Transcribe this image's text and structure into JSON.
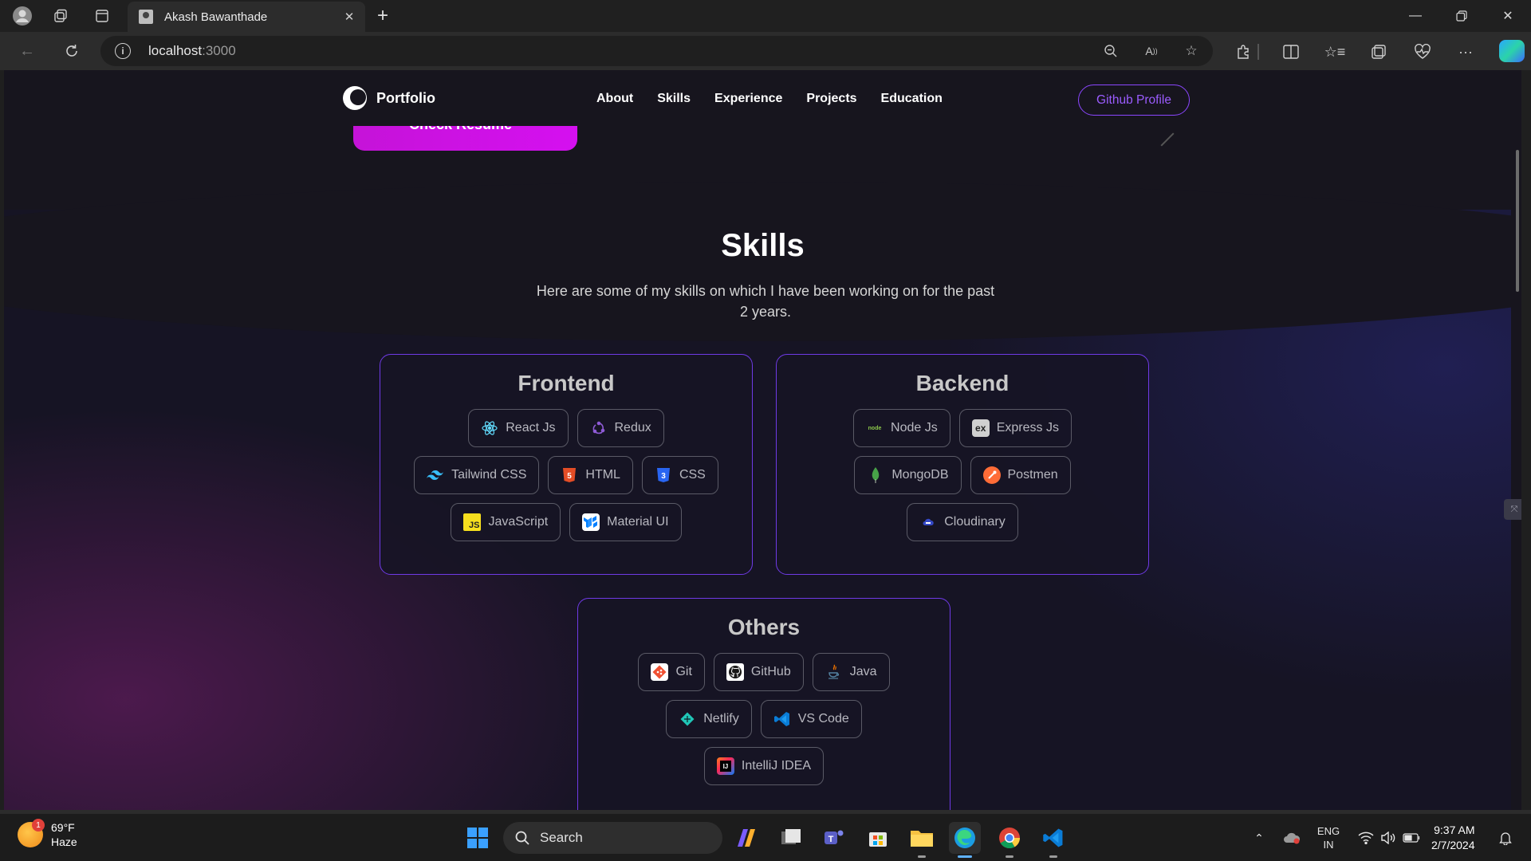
{
  "browser": {
    "tab_title": "Akash Bawanthade",
    "url_host": "localhost",
    "url_port": ":3000"
  },
  "site": {
    "logo_text": "Portfolio",
    "nav": [
      "About",
      "Skills",
      "Experience",
      "Projects",
      "Education"
    ],
    "github_button": "Github Profile",
    "resume_button": "Check Resume"
  },
  "skills": {
    "title": "Skills",
    "description": "Here are some of my skills on which I have been working on for the past 2 years.",
    "frontend": {
      "title": "Frontend",
      "rows": [
        [
          {
            "label": "React Js",
            "icon": "react-icon"
          },
          {
            "label": "Redux",
            "icon": "redux-icon"
          }
        ],
        [
          {
            "label": "Tailwind CSS",
            "icon": "tailwind-icon"
          },
          {
            "label": "HTML",
            "icon": "html-icon"
          },
          {
            "label": "CSS",
            "icon": "css-icon"
          }
        ],
        [
          {
            "label": "JavaScript",
            "icon": "javascript-icon"
          },
          {
            "label": "Material UI",
            "icon": "material-ui-icon"
          }
        ]
      ]
    },
    "backend": {
      "title": "Backend",
      "rows": [
        [
          {
            "label": "Node Js",
            "icon": "nodejs-icon"
          },
          {
            "label": "Express Js",
            "icon": "express-icon"
          }
        ],
        [
          {
            "label": "MongoDB",
            "icon": "mongodb-icon"
          },
          {
            "label": "Postmen",
            "icon": "postman-icon"
          }
        ],
        [
          {
            "label": "Cloudinary",
            "icon": "cloudinary-icon"
          }
        ]
      ]
    },
    "others": {
      "title": "Others",
      "rows": [
        [
          {
            "label": "Git",
            "icon": "git-icon"
          },
          {
            "label": "GitHub",
            "icon": "github-icon"
          },
          {
            "label": "Java",
            "icon": "java-icon"
          }
        ],
        [
          {
            "label": "Netlify",
            "icon": "netlify-icon"
          },
          {
            "label": "VS Code",
            "icon": "vscode-icon"
          }
        ],
        [
          {
            "label": "IntelliJ IDEA",
            "icon": "intellij-icon"
          }
        ]
      ]
    }
  },
  "taskbar": {
    "weather_temp": "69°F",
    "weather_desc": "Haze",
    "weather_badge": "1",
    "search_label": "Search",
    "lang_1": "ENG",
    "lang_2": "IN",
    "time": "9:37 AM",
    "date": "2/7/2024"
  },
  "colors": {
    "accent_purple": "#8b46ff",
    "card_border": "#6f3ae6",
    "resume_gradient": "#c513d8"
  }
}
